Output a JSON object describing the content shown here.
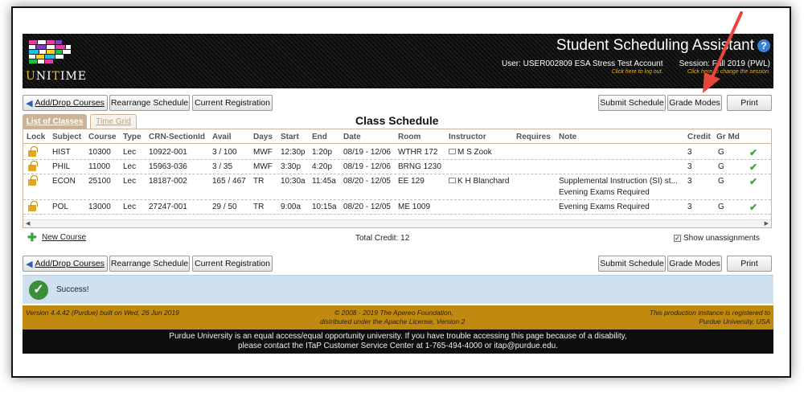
{
  "header": {
    "app_title": "Student Scheduling Assistant",
    "logo_text_u": "U",
    "logo_text_rest": "NI",
    "logo_text_t": "T",
    "logo_text_rest2": "IME",
    "user_label": "User: USER002809 ESA Stress Test Account",
    "user_hint": "Click here to log out.",
    "session_label": "Session: Fall 2019 (PWL)",
    "session_hint": "Click here to change the session."
  },
  "toolbar": {
    "add_drop": "Add/Drop Courses",
    "rearrange": "Rearrange Schedule",
    "current_registration": "Current Registration",
    "submit": "Submit Schedule",
    "grade_modes": "Grade Modes",
    "print": "Print"
  },
  "tabs": {
    "list": "List of Classes",
    "grid": "Time Grid"
  },
  "section_title": "Class Schedule",
  "columns": [
    "Lock",
    "Subject",
    "Course",
    "Type",
    "CRN-SectionId",
    "Avail",
    "Days",
    "Start",
    "End",
    "Date",
    "Room",
    "Instructor",
    "Requires",
    "Note",
    "Credit",
    "Gr Md"
  ],
  "rows": [
    {
      "subject": "HIST",
      "course": "10300",
      "type": "Lec",
      "crn": "10922-001",
      "avail": "3 / 100",
      "days": "MWF",
      "start": "12:30p",
      "end": "1:20p",
      "date": "08/19 - 12/06",
      "room": "WTHR 172",
      "instructor": "M S Zook",
      "note": "",
      "note2": "",
      "credit": "3",
      "grmd": "G"
    },
    {
      "subject": "PHIL",
      "course": "11000",
      "type": "Lec",
      "crn": "15963-036",
      "avail": "3 / 35",
      "days": "MWF",
      "start": "3:30p",
      "end": "4:20p",
      "date": "08/19 - 12/06",
      "room": "BRNG 1230",
      "instructor": "",
      "note": "",
      "note2": "",
      "credit": "3",
      "grmd": "G"
    },
    {
      "subject": "ECON",
      "course": "25100",
      "type": "Lec",
      "crn": "18187-002",
      "avail": "165 / 467",
      "days": "TR",
      "start": "10:30a",
      "end": "11:45a",
      "date": "08/20 - 12/05",
      "room": "EE 129",
      "instructor": "K H Blanchard",
      "note": "Supplemental Instruction (SI) st...",
      "note2": "Evening Exams Required",
      "credit": "3",
      "grmd": "G"
    },
    {
      "subject": "POL",
      "course": "13000",
      "type": "Lec",
      "crn": "27247-001",
      "avail": "29 / 50",
      "days": "TR",
      "start": "9:00a",
      "end": "10:15a",
      "date": "08/20 - 12/05",
      "room": "ME 1009",
      "instructor": "",
      "note": "Evening Exams Required",
      "note2": "",
      "credit": "3",
      "grmd": "G"
    }
  ],
  "footer": {
    "new_course": "New Course",
    "total_credit": "Total Credit: 12",
    "show_unassignments": "Show unassignments"
  },
  "status": {
    "message": "Success!"
  },
  "version": {
    "left": "Version 4.4.42 (Purdue) built on Wed, 26 Jun 2019",
    "center1": "© 2008 - 2019 The Apereo Foundation,",
    "center2": "distributed under the Apache License, Version 2",
    "right1": "This production instance is registered to",
    "right2": "Purdue University, USA"
  },
  "bottom": {
    "line1": "Purdue University is an equal access/equal opportunity university. If you have trouble accessing this page because of a disability,",
    "line2": "please contact the ITaP Customer Service Center at 1-765-494-4000 or itap@purdue.edu."
  },
  "colors": {
    "accent": "#c08a10",
    "tab": "#c9b497",
    "success_bg": "#cfe0ef",
    "annotation_arrow": "#e8453c"
  }
}
